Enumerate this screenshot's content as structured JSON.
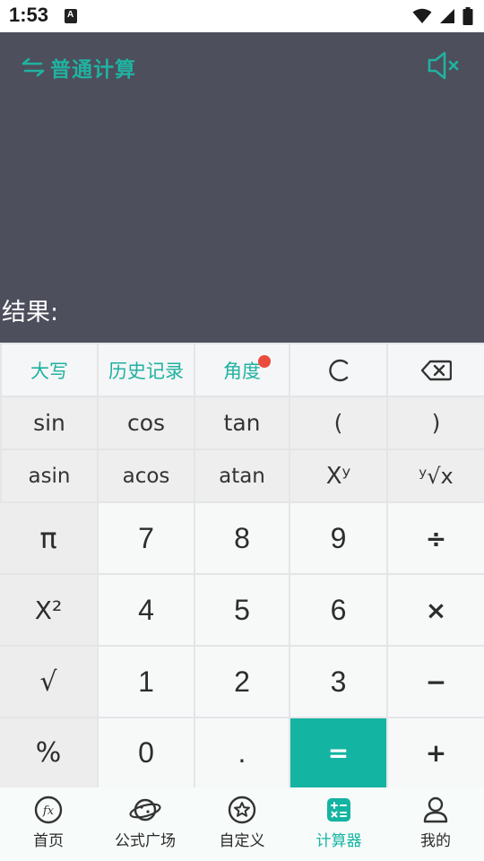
{
  "status_bar": {
    "time": "1:53"
  },
  "header": {
    "mode_label": "普通计算",
    "result_label": "结果:"
  },
  "keypad": {
    "row0": [
      "大写",
      "历史记录",
      "角度",
      "C",
      "⌫"
    ],
    "row1": [
      "sin",
      "cos",
      "tan",
      "(",
      ")"
    ],
    "row2": [
      "asin",
      "acos",
      "atan",
      "Xʸ",
      "ʸ√x"
    ],
    "row3": [
      "π",
      "7",
      "8",
      "9",
      "÷"
    ],
    "row4": [
      "X²",
      "4",
      "5",
      "6",
      "×"
    ],
    "row5": [
      "√",
      "1",
      "2",
      "3",
      "−"
    ],
    "row6": [
      "%",
      "0",
      ".",
      "=",
      "+"
    ]
  },
  "nav": {
    "items": [
      {
        "label": "首页",
        "icon": "fx-icon"
      },
      {
        "label": "公式广场",
        "icon": "planet-icon"
      },
      {
        "label": "自定义",
        "icon": "star-badge-icon"
      },
      {
        "label": "计算器",
        "icon": "calculator-icon"
      },
      {
        "label": "我的",
        "icon": "user-icon"
      }
    ],
    "active_index": 3
  },
  "colors": {
    "accent": "#14b4a2",
    "display_bg": "#4d4f5c",
    "badge": "#ec4c3d"
  }
}
